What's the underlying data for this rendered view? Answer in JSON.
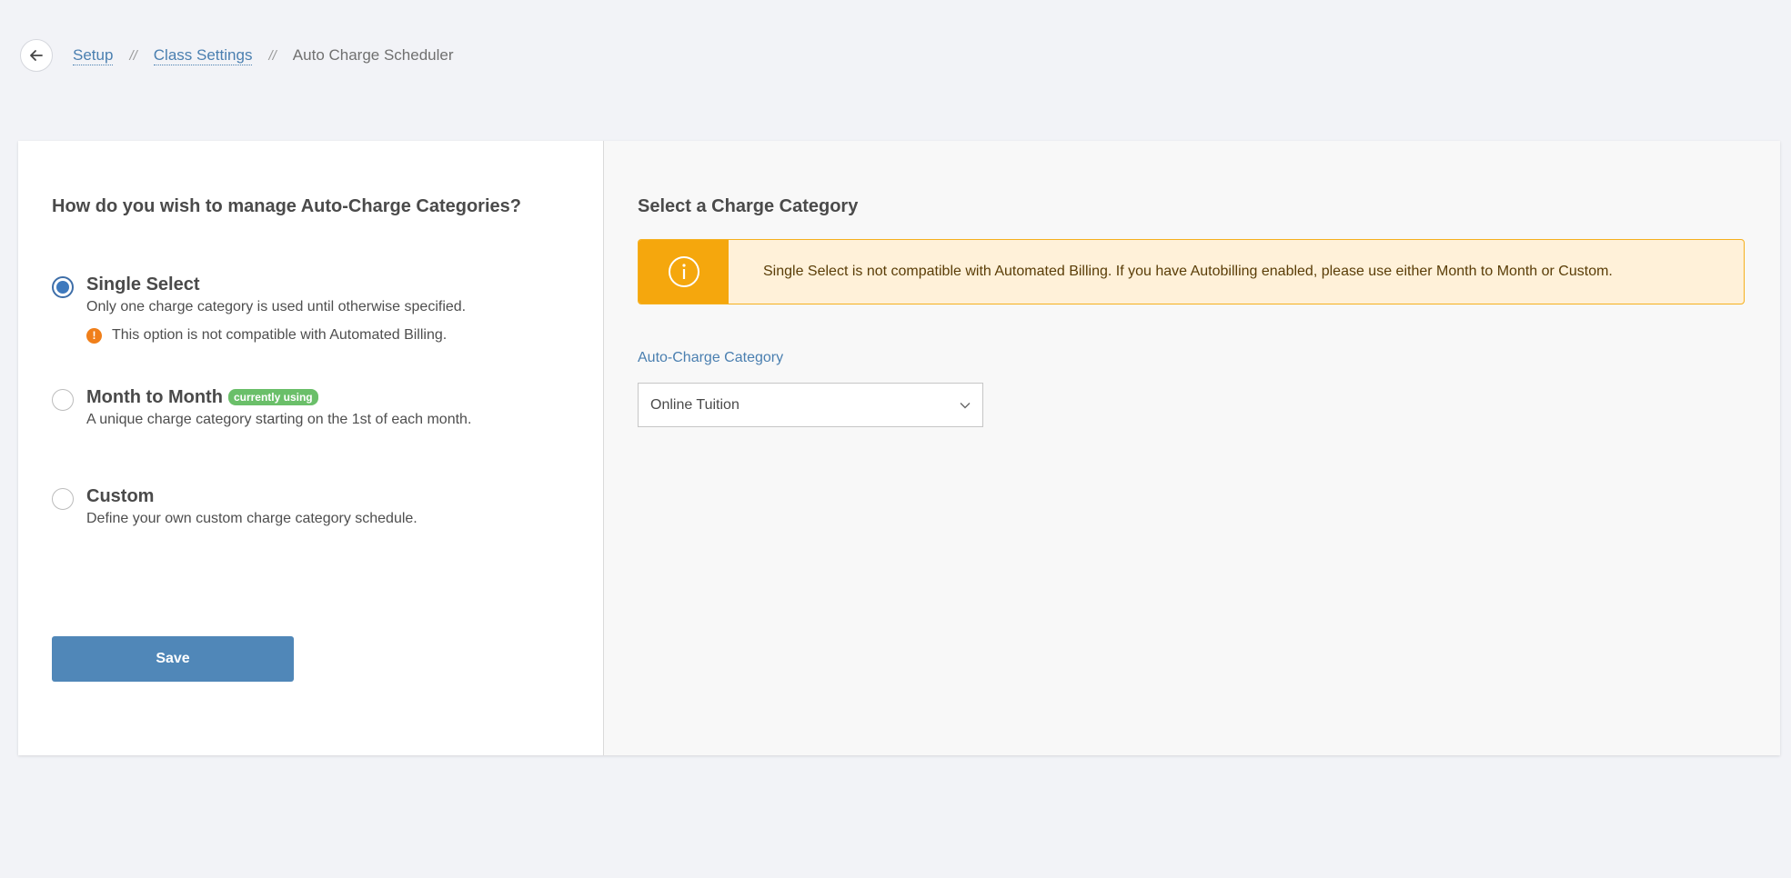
{
  "breadcrumb": {
    "items": [
      {
        "label": "Setup"
      },
      {
        "label": "Class Settings"
      }
    ],
    "separator": "//",
    "current": "Auto Charge Scheduler"
  },
  "left": {
    "question": "How do you wish to manage Auto-Charge Categories?",
    "options": [
      {
        "title": "Single Select",
        "description": "Only one charge category is used until otherwise specified.",
        "warning": "This option is not compatible with Automated Billing.",
        "selected": true
      },
      {
        "title": "Month to Month",
        "badge": "currently using",
        "description": "A unique charge category starting on the 1st of each month.",
        "selected": false
      },
      {
        "title": "Custom",
        "description": "Define your own custom charge category schedule.",
        "selected": false
      }
    ],
    "save_label": "Save"
  },
  "right": {
    "title": "Select a Charge Category",
    "alert_text": "Single Select is not compatible with Automated Billing. If you have Autobilling enabled, please use either Month to Month or Custom.",
    "field_label": "Auto-Charge Category",
    "selected_value": "Online Tuition"
  },
  "colors": {
    "accent": "#5087b8",
    "alert_bg": "#fff1d9",
    "alert_icon_bg": "#f5a70d",
    "badge": "#6abf69",
    "warning": "#f07f1a"
  }
}
